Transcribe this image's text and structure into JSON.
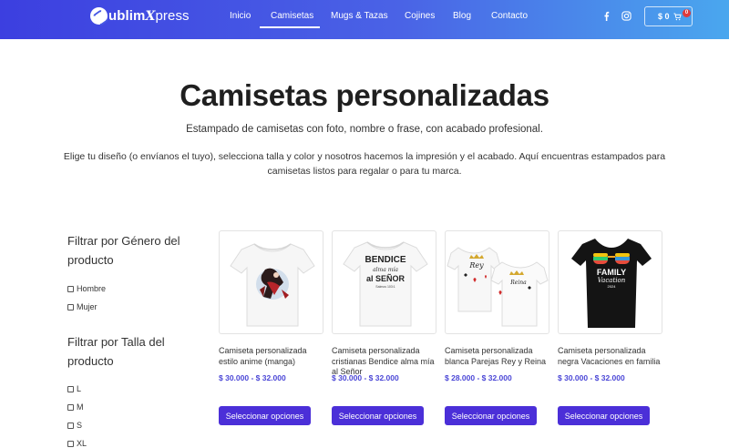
{
  "header": {
    "logo": {
      "part1": "ublim",
      "part2": "press",
      "mark": "X"
    },
    "nav": [
      {
        "label": "Inicio",
        "active": false
      },
      {
        "label": "Camisetas",
        "active": true
      },
      {
        "label": "Mugs & Tazas",
        "active": false
      },
      {
        "label": "Cojines",
        "active": false
      },
      {
        "label": "Blog",
        "active": false
      },
      {
        "label": "Contacto",
        "active": false
      }
    ],
    "social": [
      "facebook-icon",
      "instagram-icon"
    ],
    "cart": {
      "amount": "$ 0",
      "count": "0"
    }
  },
  "main": {
    "title": "Camisetas personalizadas",
    "subtitle": "Estampado de camisetas con foto, nombre o frase, con acabado profesional.",
    "intro": "Elige tu diseño (o envíanos el tuyo), selecciona talla y color y nosotros hacemos la impresión y el acabado. Aquí encuentras estampados para camisetas listos para regalar o para tu marca."
  },
  "filters": {
    "gender": {
      "title": "Filtrar por Género del producto",
      "options": [
        "Hombre",
        "Mujer"
      ]
    },
    "size": {
      "title": "Filtrar por Talla del producto",
      "options": [
        "L",
        "M",
        "S",
        "XL"
      ]
    }
  },
  "products": [
    {
      "name": "Camiseta personalizada estilo anime (manga)",
      "price": "$ 30.000 - $ 32.000",
      "button": "Seleccionar opciones"
    },
    {
      "name": "Camiseta personalizada cristianas Bendice alma mía al Señor",
      "price": "$ 30.000 - $ 32.000",
      "button": "Seleccionar opciones",
      "print": {
        "line1": "BENDICE",
        "line2": "alma mía",
        "line3": "al SEÑOR",
        "line4": "Salmos 103:1"
      }
    },
    {
      "name": "Camiseta personalizada blanca Parejas Rey y Reina",
      "price": "$ 28.000 - $ 32.000",
      "button": "Seleccionar opciones",
      "print": {
        "line1": "Rey",
        "line2": "Reina"
      }
    },
    {
      "name": "Camiseta personalizada negra Vacaciones en familia",
      "price": "$ 30.000 - $ 32.000",
      "button": "Seleccionar opciones",
      "print": {
        "line1": "FAMILY",
        "line2": "Vacation",
        "line3": "2024"
      }
    }
  ],
  "colors": {
    "accent": "#4b2fd8",
    "price": "#4a46d6",
    "header_start": "#3c3fe0",
    "header_end": "#4aa7ee"
  }
}
